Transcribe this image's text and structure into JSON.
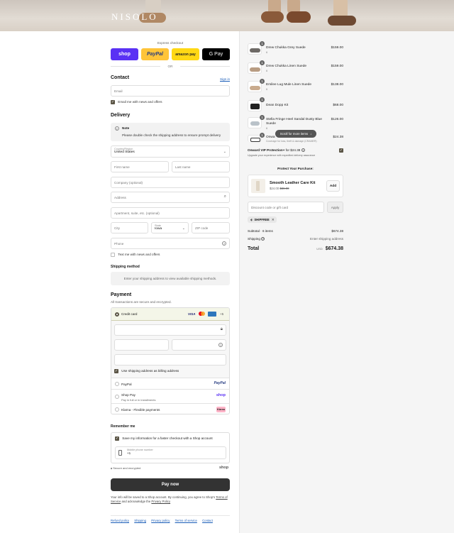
{
  "brand": "NISOLO",
  "express": {
    "label": "Express checkout",
    "or": "OR",
    "buttons": [
      "shop",
      "PayPal",
      "amazon pay",
      "G Pay"
    ]
  },
  "contact": {
    "heading": "Contact",
    "sign_in": "Sign in",
    "email_placeholder": "Email",
    "news_label": "Email me with news and offers"
  },
  "delivery": {
    "heading": "Delivery",
    "note_title": "Note",
    "note_text": "Please double check the shipping address to ensure prompt delivery",
    "country_label": "Country/Region",
    "country_value": "United States",
    "first_name": "First name",
    "last_name": "Last name",
    "company": "Company (optional)",
    "address": "Address",
    "apartment": "Apartment, suite, etc. (optional)",
    "city": "City",
    "state_label": "State",
    "state_value": "Iowa",
    "zip": "ZIP code",
    "phone": "Phone",
    "text_news": "Text me with news and offers"
  },
  "shipping": {
    "heading": "Shipping method",
    "placeholder": "Enter your shipping address to view available shipping methods."
  },
  "payment": {
    "heading": "Payment",
    "subtitle": "All transactions are secure and encrypted.",
    "credit_card": "Credit card",
    "card_more": "+5",
    "billing_same": "Use shipping address as billing address",
    "paypal": "PayPal",
    "paypal_logo": "PayPal",
    "shop_pay": "Shop Pay",
    "shop_pay_sub": "Pay in full or in installments",
    "shop_logo": "shop",
    "klarna": "Klarna - Flexible payments",
    "klarna_logo": "Klarna"
  },
  "remember": {
    "heading": "Remember me",
    "save_label": "Save my information for a faster checkout with a Shop account",
    "mobile_label": "Mobile phone number",
    "mobile_prefix": "+1",
    "secure": "Secure and encrypted",
    "shop_logo": "shop"
  },
  "pay_now": "Pay now",
  "legal": {
    "line1": "Your info will be saved to a Shop account. By continuing, you agree to Shop's",
    "terms": "Terms of Service",
    "and": "and acknowledge the",
    "privacy": "Privacy Policy"
  },
  "footer_links": [
    "Refund policy",
    "Shipping",
    "Privacy policy",
    "Terms of service",
    "Contact"
  ],
  "cart": {
    "items": [
      {
        "qty": "1",
        "name": "Drew Chukka Grey Suede",
        "sub": "6",
        "price": "$159.00"
      },
      {
        "qty": "1",
        "name": "Drew Chukka Linen Suede",
        "sub": "6",
        "price": "$159.00"
      },
      {
        "qty": "1",
        "name": "Emilee Lug Mule Linen Suede",
        "sub": "6",
        "price": "$138.00"
      },
      {
        "qty": "1",
        "name": "Dean Dopp Kit",
        "sub": "",
        "price": "$68.00"
      },
      {
        "qty": "1",
        "name": "Stella Fringe Heel Sandal Dusty Blue Suede",
        "sub": "6",
        "price": "$126.00"
      },
      {
        "qty": "1",
        "name": "Onwa",
        "sub": "Coverage for loss, theft & damage (CRAMER)",
        "price": "$24.38"
      }
    ],
    "scroll_hint": "Scroll for more items"
  },
  "onward": {
    "title": "Onward VIP Protection+",
    "for": "for $24.38",
    "desc": "Upgrade your experience with expedited delivery assurance"
  },
  "protect": {
    "heading": "Protect Your Purchase:",
    "name": "Smooth Leather Care Kit",
    "price": "$24.00",
    "was": "$36.00",
    "add": "Add"
  },
  "discount": {
    "placeholder": "Discount code or gift card",
    "apply": "Apply",
    "tag": "SHIPFREE"
  },
  "summary": {
    "subtotal_label": "Subtotal · 6 items",
    "subtotal": "$674.38",
    "shipping_label": "Shipping",
    "shipping_value": "Enter shipping address",
    "total_label": "Total",
    "currency": "USD",
    "total": "$674.38"
  },
  "colors": {
    "shop": "#5a31f4",
    "paypal": "#ffc439",
    "amazon": "#ffd814",
    "gpay": "#000000",
    "checkbox": "#5b5546",
    "pay_button": "#333333"
  }
}
